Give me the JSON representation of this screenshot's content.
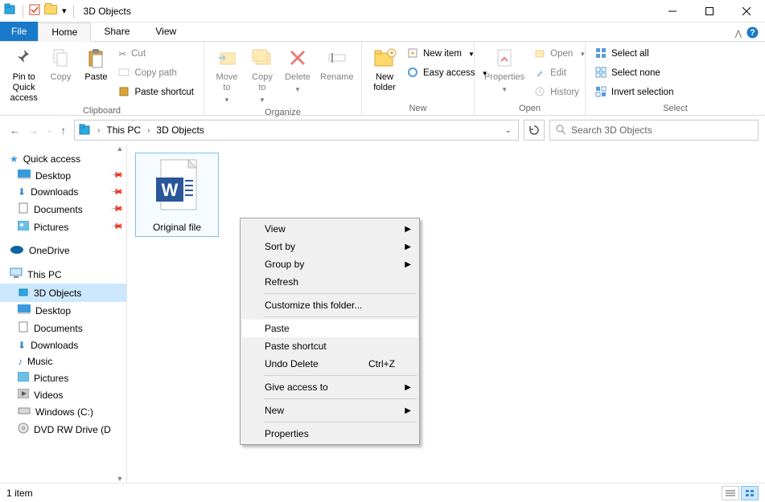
{
  "title": "3D Objects",
  "tabs": {
    "file": "File",
    "home": "Home",
    "share": "Share",
    "view": "View"
  },
  "ribbon": {
    "pin": "Pin to Quick\naccess",
    "copy": "Copy",
    "paste": "Paste",
    "cut": "Cut",
    "copypath": "Copy path",
    "pasteshortcut": "Paste shortcut",
    "clipboard": "Clipboard",
    "moveto": "Move\nto",
    "copyto": "Copy\nto",
    "delete": "Delete",
    "rename": "Rename",
    "organize": "Organize",
    "newfolder": "New\nfolder",
    "newitem": "New item",
    "easyaccess": "Easy access",
    "new": "New",
    "properties": "Properties",
    "open": "Open",
    "edit": "Edit",
    "history": "History",
    "opengroup": "Open",
    "selectall": "Select all",
    "selectnone": "Select none",
    "invert": "Invert selection",
    "select": "Select"
  },
  "breadcrumb": {
    "root": "This PC",
    "folder": "3D Objects"
  },
  "search_placeholder": "Search 3D Objects",
  "sidebar": {
    "quick": "Quick access",
    "desktop": "Desktop",
    "downloads": "Downloads",
    "documents": "Documents",
    "pictures": "Pictures",
    "onedrive": "OneDrive",
    "thispc": "This PC",
    "objects3d": "3D Objects",
    "desktop2": "Desktop",
    "documents2": "Documents",
    "downloads2": "Downloads",
    "music": "Music",
    "pictures2": "Pictures",
    "videos": "Videos",
    "windowsc": "Windows  (C:)",
    "dvd": "DVD RW Drive (D"
  },
  "file": {
    "name": "Original file"
  },
  "context": {
    "view": "View",
    "sortby": "Sort by",
    "groupby": "Group by",
    "refresh": "Refresh",
    "customize": "Customize this folder...",
    "paste": "Paste",
    "pasteshortcut": "Paste shortcut",
    "undodelete": "Undo Delete",
    "undoshortcut": "Ctrl+Z",
    "giveaccess": "Give access to",
    "new": "New",
    "properties": "Properties"
  },
  "status": "1 item"
}
